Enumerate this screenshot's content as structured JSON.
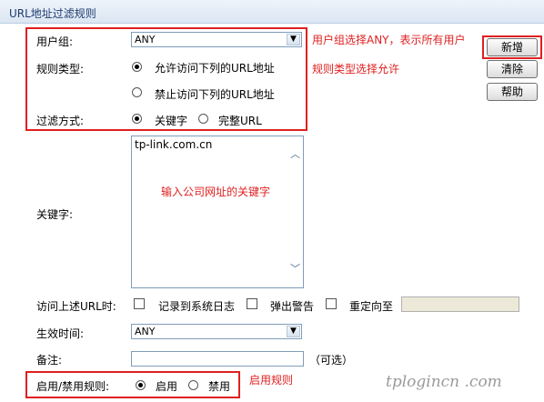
{
  "header": {
    "title": "URL地址过滤规则"
  },
  "user_group": {
    "label": "用户组:",
    "value": "ANY"
  },
  "rule_type": {
    "label": "规则类型:",
    "options": [
      "允许访问下列的URL地址",
      "禁止访问下列的URL地址"
    ],
    "selected": 0
  },
  "filter_mode": {
    "label": "过滤方式:",
    "options": [
      "关键字",
      "完整URL"
    ],
    "selected": 0
  },
  "keyword": {
    "label": "关键字:",
    "value": "tp-link.com.cn"
  },
  "on_access": {
    "label": "访问上述URL时:",
    "options": [
      "记录到系统日志",
      "弹出警告",
      "重定向至"
    ],
    "redirect_value": ""
  },
  "effective_time": {
    "label": "生效时间:",
    "value": "ANY"
  },
  "remark": {
    "label": "备注:",
    "value": "",
    "hint": "（可选）"
  },
  "enable_rule": {
    "label": "启用/禁用规则:",
    "options": [
      "启用",
      "禁用"
    ],
    "selected": 0
  },
  "buttons": {
    "add": "新增",
    "clear": "清除",
    "help": "帮助"
  },
  "annotations": {
    "user_group_note": "用户组选择ANY，表示所有用户",
    "rule_type_note": "规则类型选择允许",
    "keyword_note": "输入公司网址的关键字",
    "enable_note": "启用规则"
  },
  "watermark": "tplogincn .com",
  "colors": {
    "annotation": "#e02020",
    "header_text": "#1f3c6e"
  }
}
